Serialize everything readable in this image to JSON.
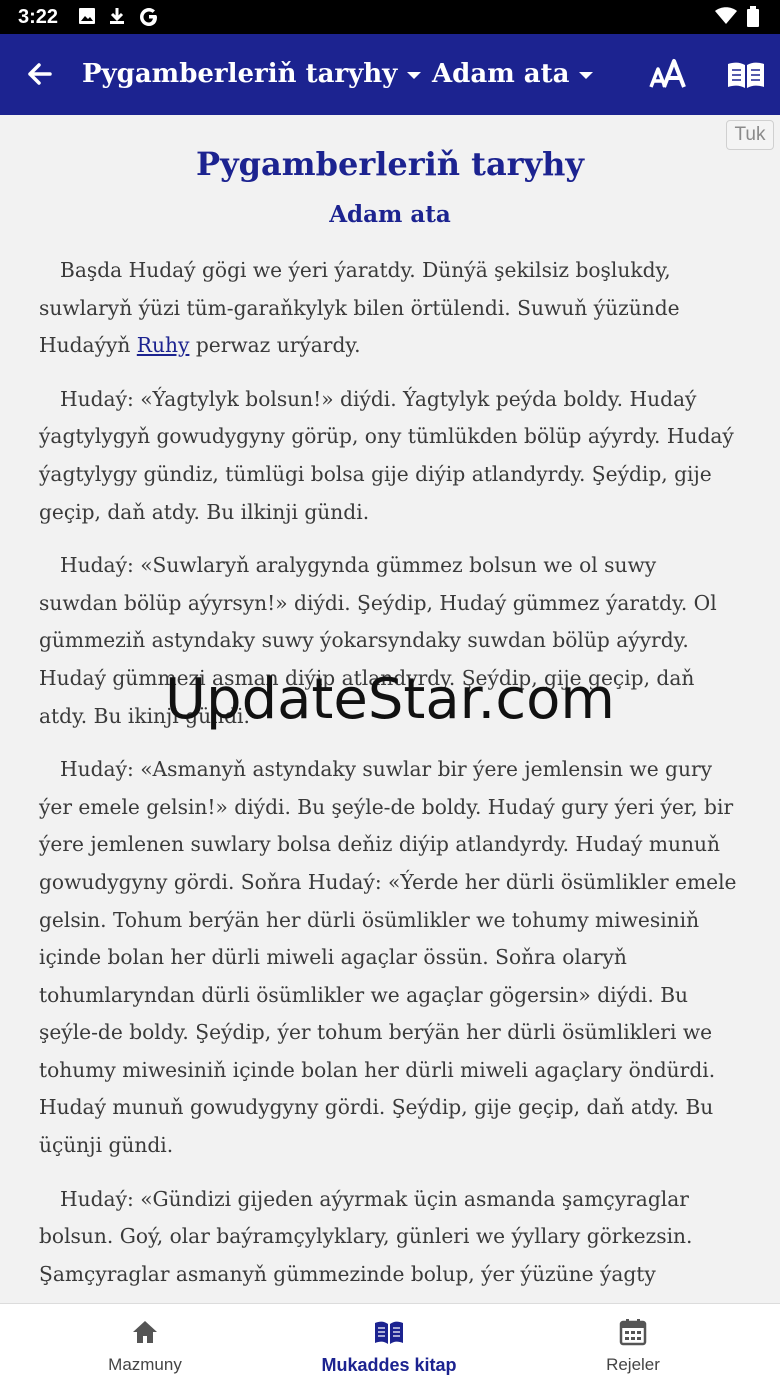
{
  "status_bar": {
    "time": "3:22",
    "icons": [
      "image-icon",
      "download-icon",
      "google-icon",
      "wifi-icon",
      "battery-icon"
    ]
  },
  "app_bar": {
    "book_selector": "Pygamberleriň taryhy",
    "chapter_selector": "Adam ata",
    "icons": [
      "back-arrow-icon",
      "dropdown-caret-icon",
      "font-size-icon",
      "book-reader-icon"
    ],
    "background_color": "#1c2390"
  },
  "content": {
    "language_tag": "Tuk",
    "book_title": "Pygamberleriň taryhy",
    "chapter_title": "Adam ata",
    "verses": [
      {
        "before_link": "Başda Hudaý gögi we ýeri ýaratdy. Dünýä şekilsiz boşlukdy, suwlaryň ýüzi tüm-garaňkylyk bilen örtülendi. Suwuň ýüzünde Hudaýyň ",
        "link": "Ruhy",
        "after_link": " perwaz urýardy."
      },
      {
        "text": "Hudaý: «Ýagtylyk bolsun!» diýdi. Ýagtylyk peýda boldy. Hudaý ýagtylygyň gowudygyny görüp, ony tümlükden bölüp aýyrdy. Hudaý ýagtylygy gündiz, tümlügi bolsa gije diýip atlandyrdy. Şeýdip, gije geçip, daň atdy. Bu ilkinji gündi."
      },
      {
        "text": "Hudaý: «Suwlaryň aralygynda gümmez bolsun we ol suwy suwdan bölüp aýyrsyn!» diýdi. Şeýdip, Hudaý gümmez ýaratdy. Ol gümmeziň astyndaky suwy ýokarsyndaky suwdan bölüp aýyrdy. Hudaý gümmezi asman diýip atlandyrdy. Şeýdip, gije geçip, daň atdy. Bu ikinji gündi."
      },
      {
        "text": "Hudaý: «Asmanyň astyndaky suwlar bir ýere jemlensin we gury ýer emele gelsin!» diýdi. Bu şeýle-de boldy. Hudaý gury ýeri ýer, bir ýere jemlenen suwlary bolsa deňiz diýip atlandyrdy. Hudaý munuň gowudygyny gördi. Soňra Hudaý: «Ýerde her dürli ösümlikler emele gelsin. Tohum berýän her dürli ösümlikler we tohumy miwesiniň içinde bolan her dürli miweli agaçlar össün. Soňra olaryň tohumlaryndan dürli ösümlikler we agaçlar gögersin» diýdi. Bu şeýle-de boldy. Şeýdip, ýer tohum berýän her dürli ösümlikleri we tohumy miwesiniň içinde bolan her dürli miweli agaçlary öndürdi. Hudaý munuň gowudygyny gördi. Şeýdip, gije geçip, daň atdy. Bu üçünji gündi."
      },
      {
        "text": "Hudaý: «Gündizi gijeden aýyrmak üçin asmanda şamçyraglar bolsun. Goý, olar baýramçylyklary, günleri we ýyllary görkezsin. Şamçyraglar asmanyň gümmezinde bolup, ýer ýüzüne ýagty"
      }
    ],
    "watermark": "UpdateStar.com"
  },
  "bottom_nav": {
    "items": [
      {
        "label": "Mazmuny",
        "icon": "home-icon"
      },
      {
        "label": "Mukaddes kitap",
        "icon": "open-book-icon",
        "active": true
      },
      {
        "label": "Rejeler",
        "icon": "calendar-icon"
      }
    ],
    "active_color": "#1c2390"
  }
}
